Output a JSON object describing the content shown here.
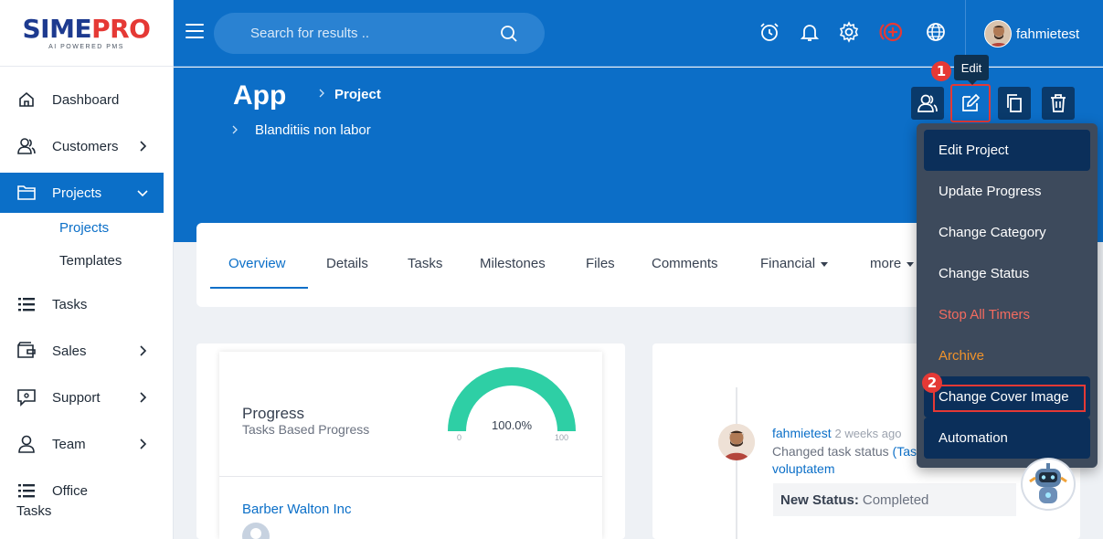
{
  "brand": {
    "name_part1": "SIME",
    "name_part2": "PRO",
    "tagline": "AI POWERED PMS",
    "color_primary": "#1d3a8f",
    "color_accent": "#e53935"
  },
  "header": {
    "search_placeholder": "Search for results ..",
    "icons": [
      "alarm-clock-icon",
      "bell-icon",
      "gear-icon",
      "add-circle-icon",
      "globe-icon"
    ],
    "username": "fahmietest",
    "accent_color": "#0c6ec7"
  },
  "sidebar": {
    "items": [
      {
        "label": "Dashboard",
        "icon": "home-icon"
      },
      {
        "label": "Customers",
        "icon": "users-icon"
      },
      {
        "label": "Projects",
        "icon": "folder-icon"
      },
      {
        "label": "Tasks",
        "icon": "list-icon"
      },
      {
        "label": "Sales",
        "icon": "wallet-icon"
      },
      {
        "label": "Support",
        "icon": "support-icon"
      },
      {
        "label": "Team",
        "icon": "user-icon"
      },
      {
        "label": "Office",
        "label_line2": "Tasks",
        "icon": "list-icon"
      }
    ],
    "projects_sub": [
      {
        "label": "Projects"
      },
      {
        "label": "Templates"
      }
    ]
  },
  "page": {
    "title": "App",
    "breadcrumb": [
      "Project",
      "Blanditiis non labor"
    ],
    "tooltip": "Edit",
    "step1": "1",
    "step2": "2"
  },
  "tabs": [
    "Overview",
    "Details",
    "Tasks",
    "Milestones",
    "Files",
    "Comments",
    "Financial",
    "more"
  ],
  "progress_card": {
    "title": "Progress",
    "subtitle": "Tasks Based Progress",
    "value_label": "100.0%",
    "value": 100,
    "min": "0",
    "max": "100",
    "customer": "Barber Walton Inc",
    "gauge_color": "#2ecfa5"
  },
  "activity": {
    "user": "fahmietest",
    "time": "2 weeks ago",
    "text": "Changed task status",
    "link_part": "(Tas",
    "link_line2": "voluptatem",
    "status_label": "New Status:",
    "status_value": "Completed"
  },
  "dropdown": {
    "items": [
      {
        "label": "Edit Project"
      },
      {
        "label": "Update Progress"
      },
      {
        "label": "Change Category"
      },
      {
        "label": "Change Status"
      },
      {
        "label": "Stop All Timers"
      },
      {
        "label": "Archive"
      },
      {
        "label": "Change Cover Image"
      },
      {
        "label": "Automation"
      }
    ]
  }
}
